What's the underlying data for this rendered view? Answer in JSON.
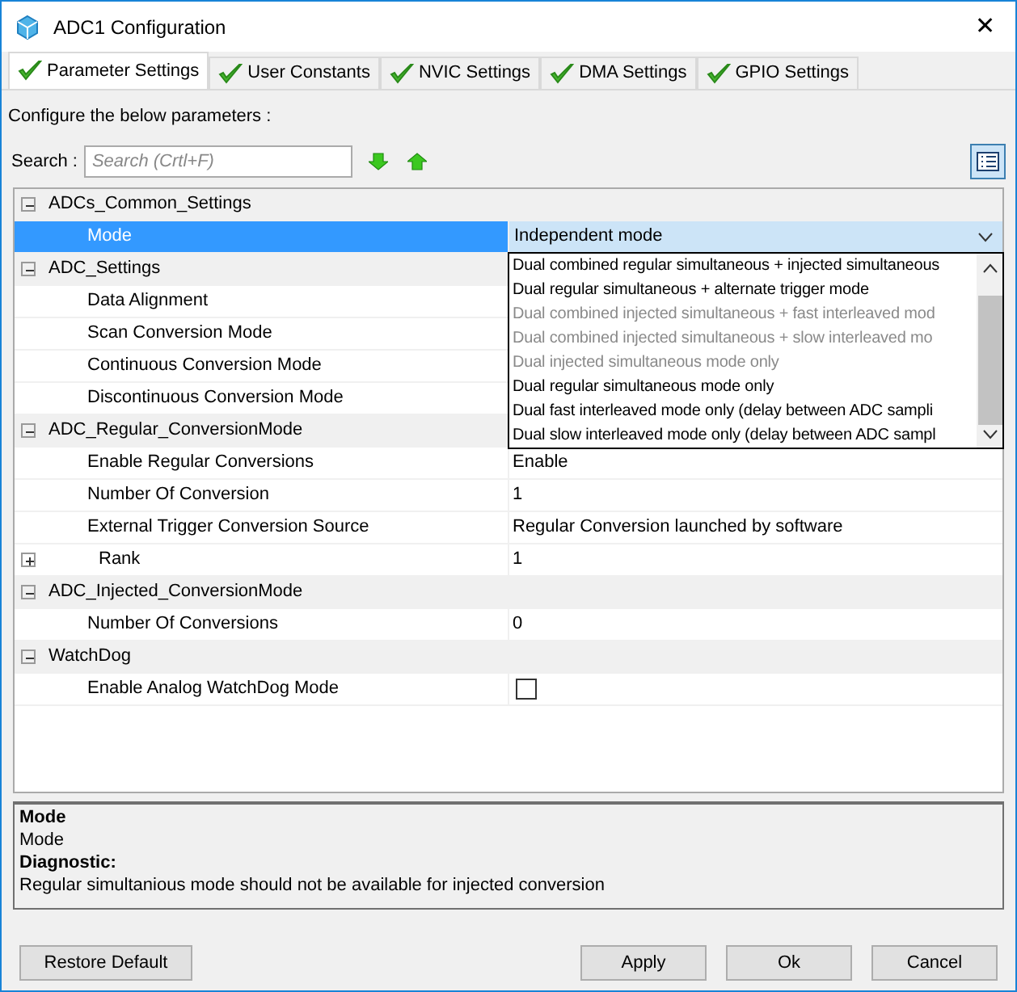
{
  "window": {
    "title": "ADC1 Configuration",
    "close": "✕"
  },
  "tabs": [
    {
      "label": "Parameter Settings",
      "selected": true
    },
    {
      "label": "User Constants",
      "selected": false
    },
    {
      "label": "NVIC Settings",
      "selected": false
    },
    {
      "label": "DMA Settings",
      "selected": false
    },
    {
      "label": "GPIO Settings",
      "selected": false
    }
  ],
  "intro": "Configure the below parameters :",
  "search": {
    "label": "Search :",
    "placeholder": "Search (Crtl+F)"
  },
  "tree": [
    {
      "label": "ADCs_Common_Settings",
      "expanded": true,
      "children": [
        {
          "label": "Mode",
          "kind": "combo",
          "value": "Independent mode",
          "selected": true
        }
      ]
    },
    {
      "label": "ADC_Settings",
      "expanded": true,
      "children": [
        {
          "label": "Data Alignment",
          "kind": "hidden",
          "selected": false
        },
        {
          "label": "Scan Conversion Mode",
          "kind": "hidden",
          "selected": false
        },
        {
          "label": "Continuous Conversion Mode",
          "kind": "hidden",
          "selected": false
        },
        {
          "label": "Discontinuous Conversion Mode",
          "kind": "hidden",
          "selected": false
        }
      ]
    },
    {
      "label": "ADC_Regular_ConversionMode",
      "expanded": true,
      "children": [
        {
          "label": "Enable Regular Conversions",
          "kind": "text",
          "value": "Enable",
          "selected": false
        },
        {
          "label": "Number Of Conversion",
          "kind": "text",
          "value": "1",
          "selected": false
        },
        {
          "label": "External Trigger Conversion Source",
          "kind": "text",
          "value": "Regular Conversion launched by software",
          "selected": false
        },
        {
          "label": "Rank",
          "kind": "text",
          "value": "1",
          "selected": false,
          "expanded": false
        }
      ]
    },
    {
      "label": "ADC_Injected_ConversionMode",
      "expanded": true,
      "children": [
        {
          "label": "Number Of Conversions",
          "kind": "text",
          "value": "0",
          "selected": false
        }
      ]
    },
    {
      "label": "WatchDog",
      "expanded": true,
      "children": [
        {
          "label": "Enable Analog WatchDog Mode",
          "kind": "checkbox",
          "checked": false,
          "selected": false
        }
      ]
    }
  ],
  "dropdown": [
    {
      "label": "Dual combined regular simultaneous + injected simultaneous",
      "disabled": false
    },
    {
      "label": "Dual regular simultaneous + alternate trigger mode",
      "disabled": false
    },
    {
      "label": "Dual combined injected simultaneous + fast interleaved mod",
      "disabled": true
    },
    {
      "label": "Dual combined injected simultaneous + slow interleaved mo",
      "disabled": true
    },
    {
      "label": "Dual injected simultaneous mode only",
      "disabled": true
    },
    {
      "label": "Dual regular simultaneous mode only",
      "disabled": false
    },
    {
      "label": "Dual fast interleaved mode only (delay between ADC sampli",
      "disabled": false
    },
    {
      "label": "Dual slow interleaved mode only (delay between ADC sampl",
      "disabled": false
    }
  ],
  "description": {
    "title": "Mode",
    "text": "Mode",
    "diagnostic_label": "Diagnostic:",
    "diagnostic": "Regular simultanious mode should not be available for injected conversion"
  },
  "buttons": {
    "restore": "Restore Default",
    "actions": [
      "Apply",
      "Ok",
      "Cancel"
    ]
  }
}
